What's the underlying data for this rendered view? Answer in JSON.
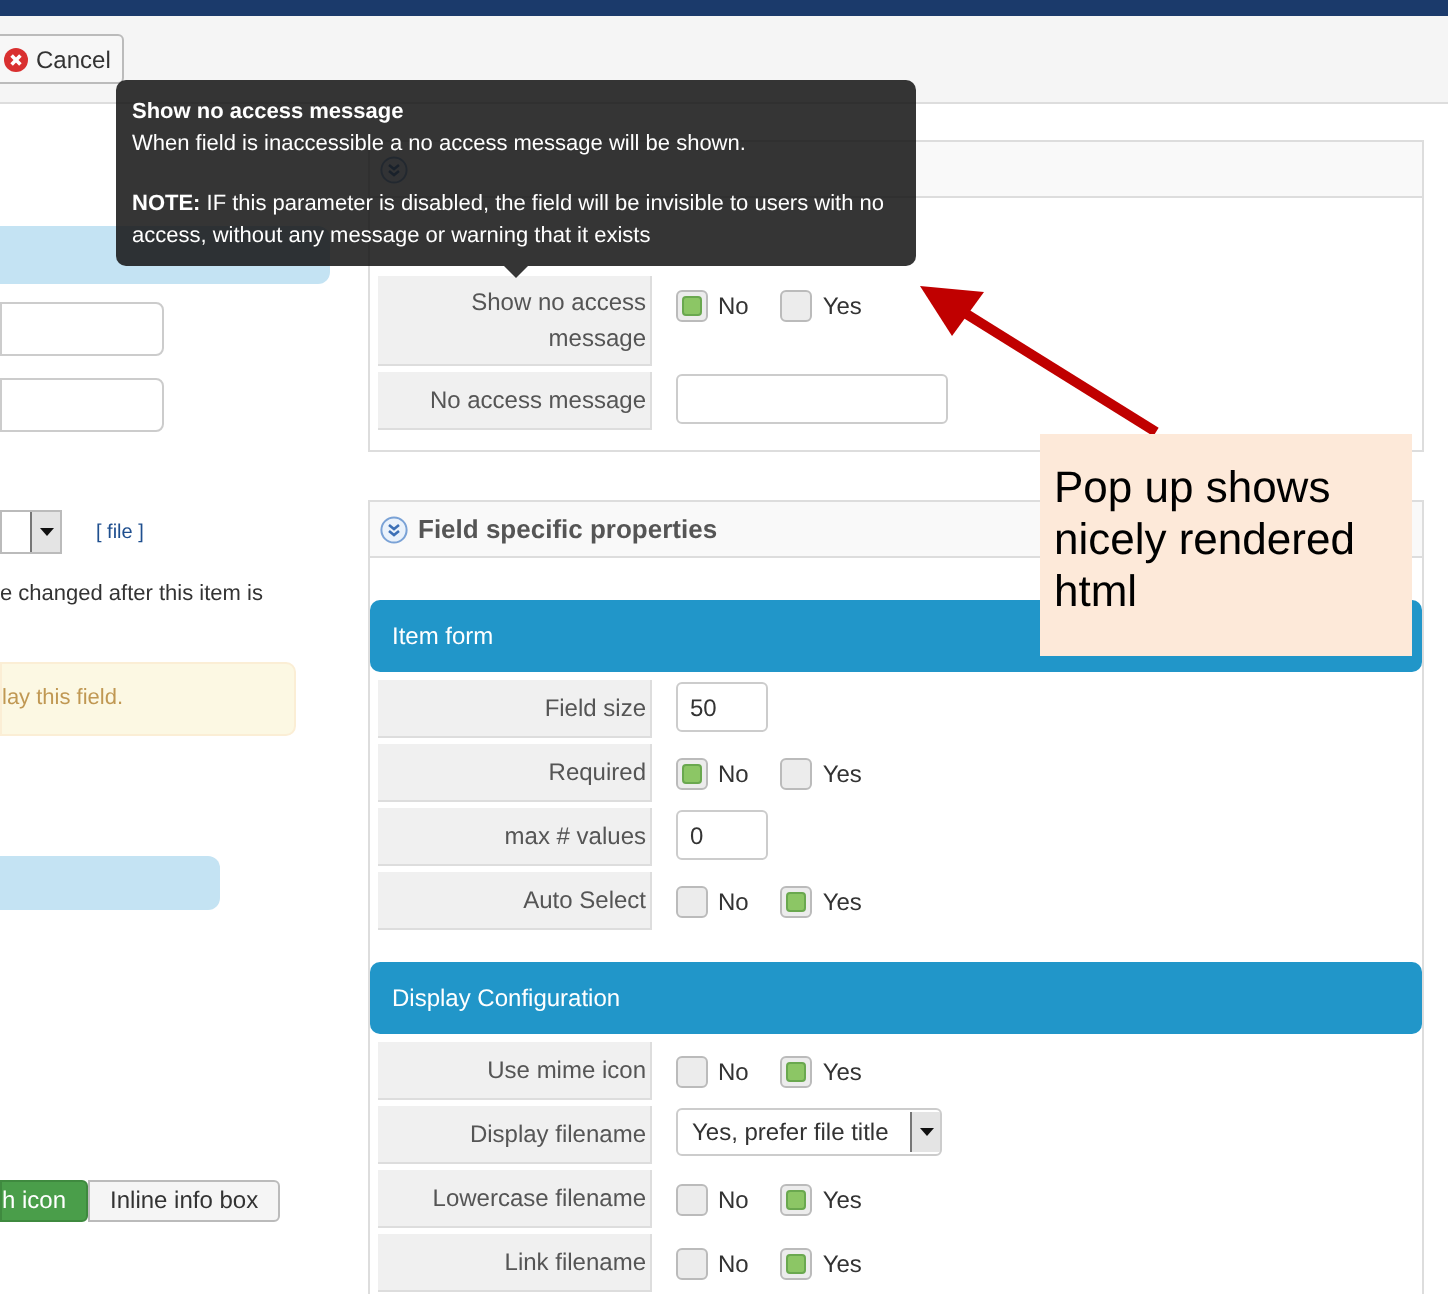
{
  "toolbar": {
    "cancel_button": "Cancel"
  },
  "left_column": {
    "file_link": "[ file ]",
    "note_text": "e changed after this item is",
    "warning_text": "lay this field.",
    "buttons": [
      {
        "label": "h icon",
        "selected": true
      },
      {
        "label": "Inline info box",
        "selected": false
      }
    ]
  },
  "standard_panel": {
    "rows": [
      {
        "kind": "toggle",
        "label": "Show no access message",
        "options": [
          {
            "label": "No",
            "selected": true
          },
          {
            "label": "Yes",
            "selected": false
          }
        ]
      },
      {
        "kind": "text",
        "label": "No access message"
      }
    ]
  },
  "specific_panel": {
    "title": "Field specific properties",
    "sections": [
      {
        "title": "Item form",
        "rows": [
          {
            "kind": "text",
            "label": "Field size",
            "value": "50"
          },
          {
            "kind": "toggle",
            "label": "Required",
            "options": [
              {
                "label": "No",
                "selected": true
              },
              {
                "label": "Yes",
                "selected": false
              }
            ]
          },
          {
            "kind": "text",
            "label": "max # values",
            "value": "0"
          },
          {
            "kind": "toggle",
            "label": "Auto Select",
            "options": [
              {
                "label": "No",
                "selected": false
              },
              {
                "label": "Yes",
                "selected": true
              }
            ]
          }
        ]
      },
      {
        "title": "Display Configuration",
        "rows": [
          {
            "kind": "toggle",
            "label": "Use mime icon",
            "options": [
              {
                "label": "No",
                "selected": false
              },
              {
                "label": "Yes",
                "selected": true
              }
            ]
          },
          {
            "kind": "select",
            "label": "Display filename",
            "value": "Yes, prefer file title"
          },
          {
            "kind": "toggle",
            "label": "Lowercase filename",
            "options": [
              {
                "label": "No",
                "selected": false
              },
              {
                "label": "Yes",
                "selected": true
              }
            ]
          },
          {
            "kind": "toggle",
            "label": "Link filename",
            "options": [
              {
                "label": "No",
                "selected": false
              },
              {
                "label": "Yes",
                "selected": true
              }
            ]
          }
        ]
      }
    ]
  },
  "tooltip": {
    "title": "Show no access message",
    "text": "When field is inaccessible a no access message will be shown.",
    "note": "**NOTE:** IF this parameter is disabled, the field will be invisible to users with no access, without any message or warning that it exists"
  },
  "callout": {
    "text": "Pop up shows nicely rendered html"
  }
}
